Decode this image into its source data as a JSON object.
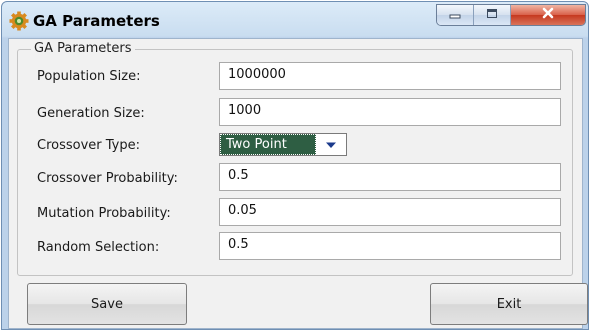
{
  "window": {
    "title": "GA Parameters",
    "icon": "gear-icon",
    "controls": {
      "minimize": "minimize-icon",
      "maximize": "maximize-icon",
      "close": "close-icon"
    }
  },
  "form": {
    "group_title": "GA Parameters",
    "fields": [
      {
        "label": "Population Size:",
        "value": "1000000"
      },
      {
        "label": "Generation Size:",
        "value": "1000"
      },
      {
        "label": "Crossover Type:",
        "value": "Two Point"
      },
      {
        "label": "Crossover Probability:",
        "value": "0.5"
      },
      {
        "label": "Mutation Probability:",
        "value": "0.05"
      },
      {
        "label": "Random Selection:",
        "value": "0.5"
      }
    ]
  },
  "buttons": {
    "save": "Save",
    "exit": "Exit"
  },
  "colors": {
    "titlebar": "#c9ddf0",
    "close_button": "#c6381f",
    "dropdown_selected": "#2e5e43",
    "client_background": "#f1f1f1"
  }
}
